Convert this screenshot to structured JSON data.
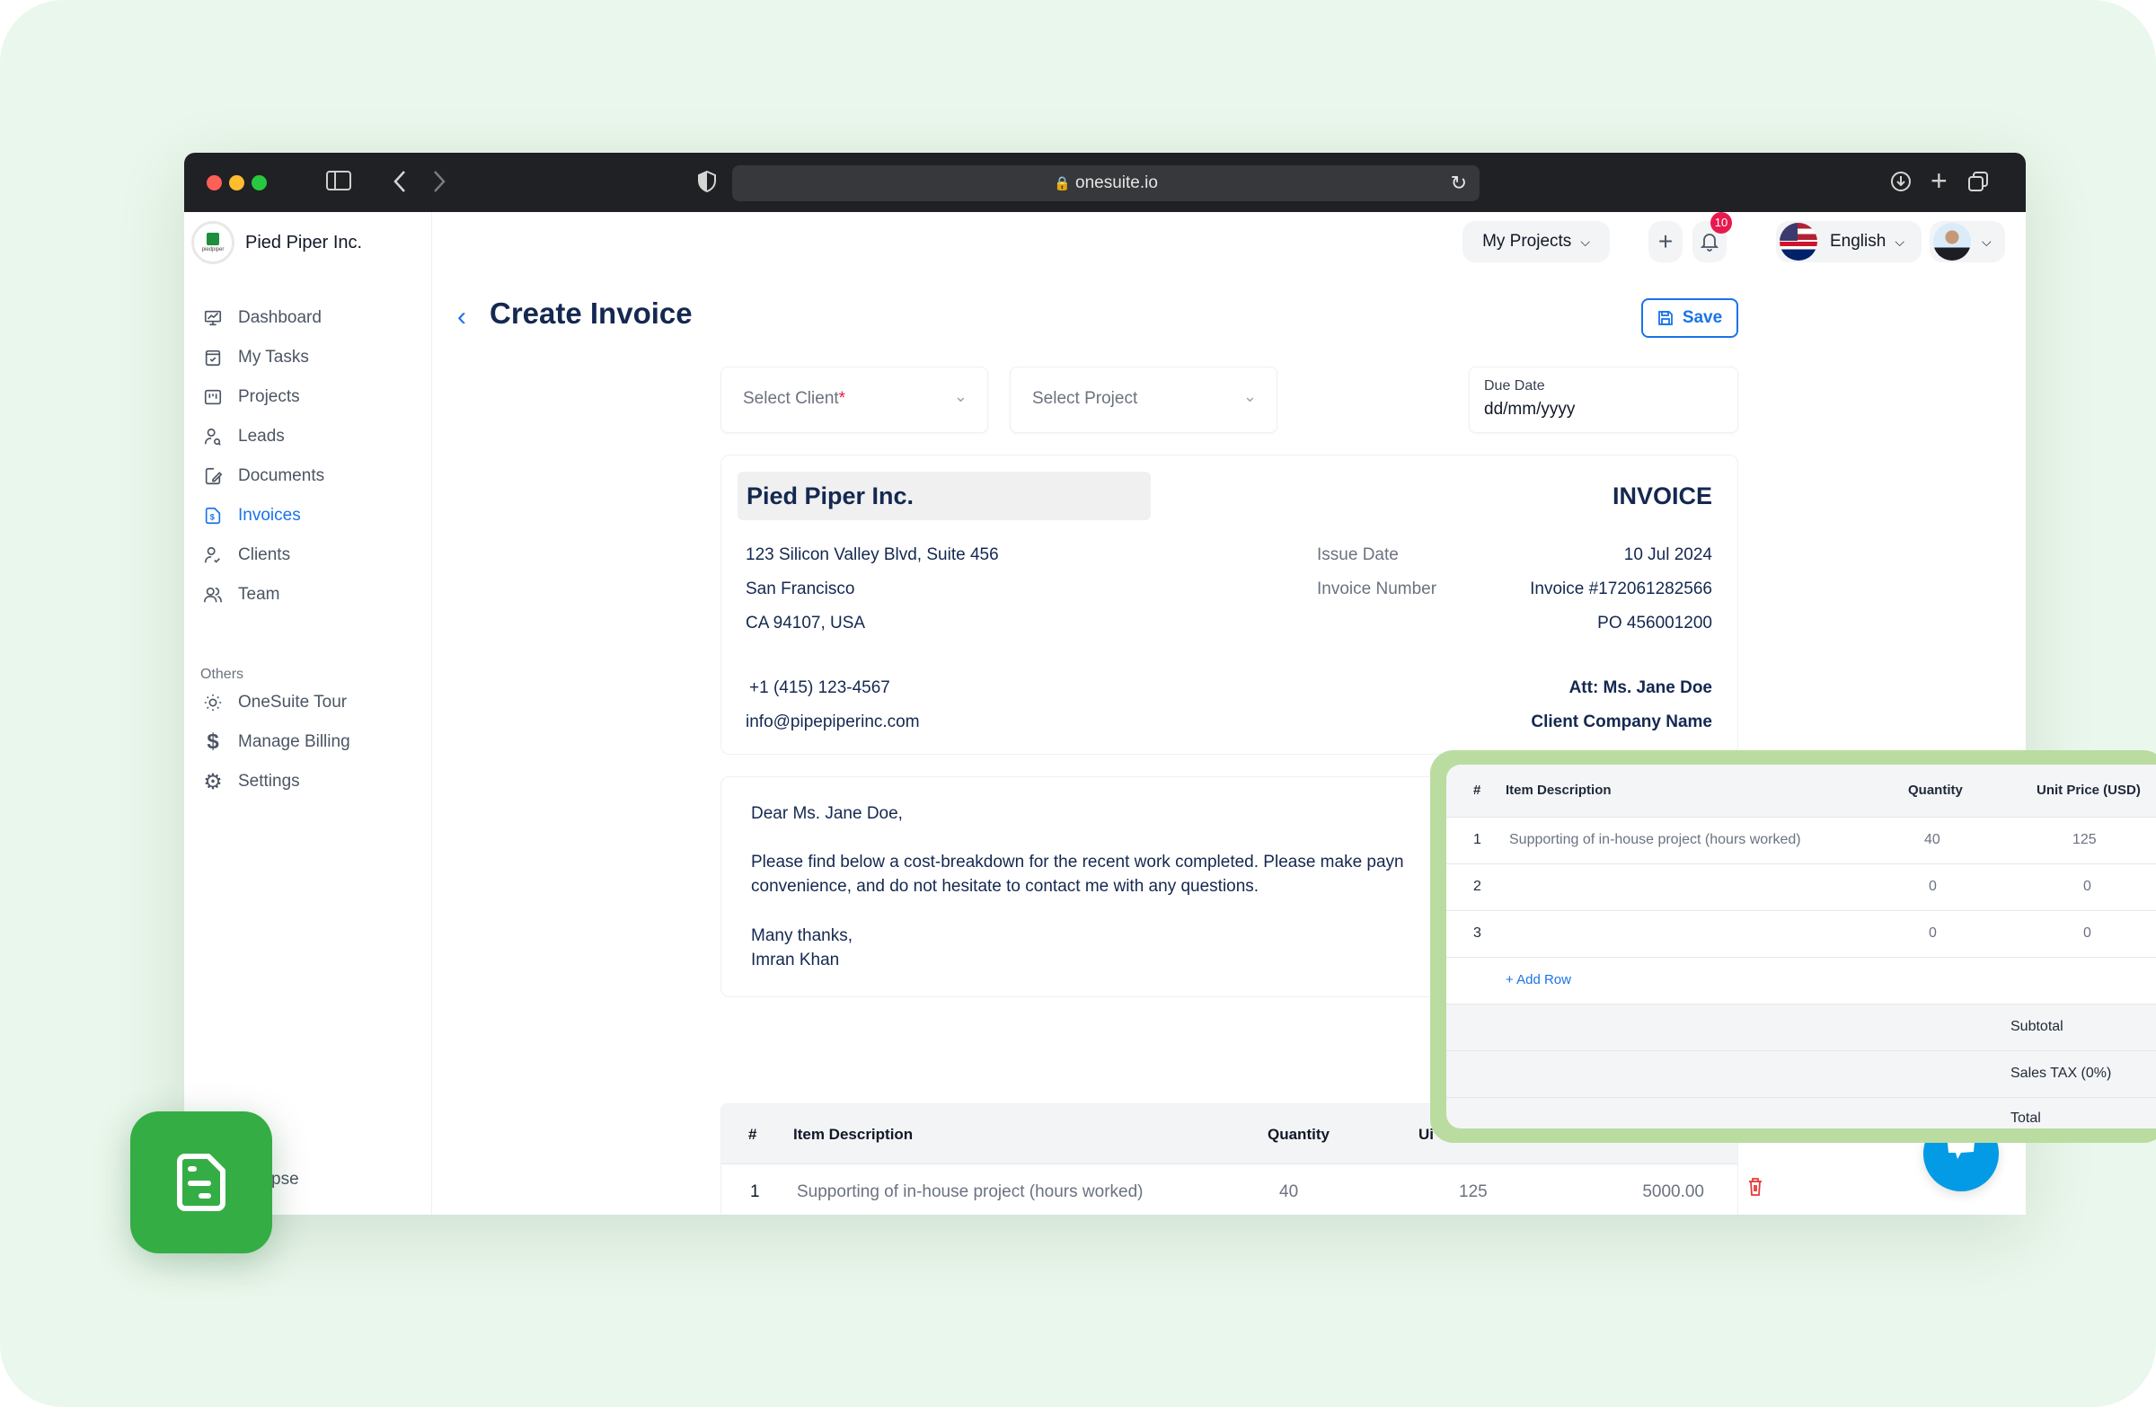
{
  "browser": {
    "url": "onesuite.io"
  },
  "brand": {
    "name": "Pied Piper Inc.",
    "logo_text": "piedpiper"
  },
  "sidebar": {
    "items": [
      {
        "label": "Dashboard",
        "icon": "dashboard-icon"
      },
      {
        "label": "My Tasks",
        "icon": "tasks-icon"
      },
      {
        "label": "Projects",
        "icon": "projects-icon"
      },
      {
        "label": "Leads",
        "icon": "leads-icon"
      },
      {
        "label": "Documents",
        "icon": "documents-icon"
      },
      {
        "label": "Invoices",
        "icon": "invoice-icon",
        "active": true
      },
      {
        "label": "Clients",
        "icon": "clients-icon"
      },
      {
        "label": "Team",
        "icon": "team-icon"
      }
    ],
    "section_label": "Others",
    "others": [
      {
        "label": "OneSuite Tour",
        "icon": "sun-icon"
      },
      {
        "label": "Manage Billing",
        "icon": "dollar-icon"
      },
      {
        "label": "Settings",
        "icon": "gear-icon"
      }
    ],
    "collapse_label": "llapse"
  },
  "topbar": {
    "projects_label": "My Projects",
    "notification_count": "10",
    "language": "English"
  },
  "page": {
    "title": "Create Invoice",
    "save_label": "Save"
  },
  "form": {
    "client_placeholder": "Select Client",
    "client_required_mark": "*",
    "project_placeholder": "Select Project",
    "due_date_label": "Due Date",
    "due_date_value": "dd/mm/yyyy"
  },
  "invoice": {
    "company_name": "Pied Piper Inc.",
    "heading": "INVOICE",
    "address": [
      "123 Silicon Valley Blvd, Suite 456",
      "San Francisco",
      "CA 94107, USA"
    ],
    "phone": "+1 (415) 123-4567",
    "email": "info@pipepiperinc.com",
    "issue_date_label": "Issue Date",
    "issue_date": "10 Jul 2024",
    "invoice_number_label": "Invoice Number",
    "invoice_number": "Invoice #172061282566",
    "po": "PO 456001200",
    "attention": "Att: Ms. Jane Doe",
    "client_company": "Client Company Name"
  },
  "letter": {
    "greeting": "Dear  Ms. Jane Doe,",
    "body_line1": "Please find below a cost-breakdown for the recent work completed. Please make payn",
    "body_line2": "convenience, and do not hesitate to contact me with any questions.",
    "closing": "Many thanks,",
    "signature": "Imran Khan"
  },
  "items_table": {
    "headers": [
      "#",
      "Item Description",
      "Quantity",
      "Ui"
    ],
    "rows": [
      {
        "num": "1",
        "description": "Supporting of in-house project (hours worked)",
        "quantity": "40",
        "unit_price": "125",
        "amount": "5000.00"
      }
    ]
  },
  "zoom_table": {
    "headers": [
      "#",
      "Item Description",
      "Quantity",
      "Unit Price (USD)"
    ],
    "rows": [
      {
        "num": "1",
        "description": "Supporting of in-house project (hours worked)",
        "quantity": "40",
        "unit_price": "125"
      },
      {
        "num": "2",
        "description": "",
        "quantity": "0",
        "unit_price": "0"
      },
      {
        "num": "3",
        "description": "",
        "quantity": "0",
        "unit_price": "0"
      }
    ],
    "add_row_label": "+ Add Row",
    "subtotal_label": "Subtotal",
    "tax_label": "Sales TAX (0%)",
    "total_label": "Total"
  },
  "colors": {
    "accent": "#1a73e8",
    "navy": "#142850",
    "brand_green": "#35ad45",
    "highlight_green": "#badca0",
    "badge_red": "#e8194f",
    "chat_blue": "#039be5"
  }
}
